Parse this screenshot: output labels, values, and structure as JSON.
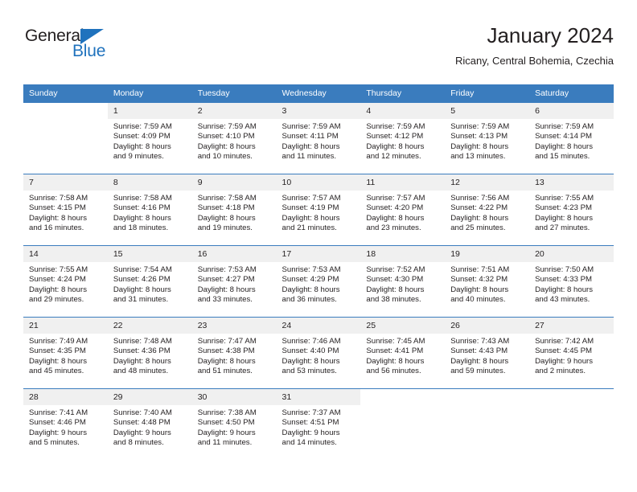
{
  "brand": {
    "name_top": "General",
    "name_bottom": "Blue",
    "color_dark": "#231f20",
    "color_blue": "#1f72bd"
  },
  "header": {
    "title": "January 2024",
    "subtitle": "Ricany, Central Bohemia, Czechia"
  },
  "theme": {
    "header_bg": "#3a7cbe",
    "daynum_bg": "#f0f0f0",
    "text": "#231f20"
  },
  "weekday_headers": [
    "Sunday",
    "Monday",
    "Tuesday",
    "Wednesday",
    "Thursday",
    "Friday",
    "Saturday"
  ],
  "weeks": [
    [
      {
        "day": "",
        "lines": []
      },
      {
        "day": "1",
        "lines": [
          "Sunrise: 7:59 AM",
          "Sunset: 4:09 PM",
          "Daylight: 8 hours",
          "and 9 minutes."
        ]
      },
      {
        "day": "2",
        "lines": [
          "Sunrise: 7:59 AM",
          "Sunset: 4:10 PM",
          "Daylight: 8 hours",
          "and 10 minutes."
        ]
      },
      {
        "day": "3",
        "lines": [
          "Sunrise: 7:59 AM",
          "Sunset: 4:11 PM",
          "Daylight: 8 hours",
          "and 11 minutes."
        ]
      },
      {
        "day": "4",
        "lines": [
          "Sunrise: 7:59 AM",
          "Sunset: 4:12 PM",
          "Daylight: 8 hours",
          "and 12 minutes."
        ]
      },
      {
        "day": "5",
        "lines": [
          "Sunrise: 7:59 AM",
          "Sunset: 4:13 PM",
          "Daylight: 8 hours",
          "and 13 minutes."
        ]
      },
      {
        "day": "6",
        "lines": [
          "Sunrise: 7:59 AM",
          "Sunset: 4:14 PM",
          "Daylight: 8 hours",
          "and 15 minutes."
        ]
      }
    ],
    [
      {
        "day": "7",
        "lines": [
          "Sunrise: 7:58 AM",
          "Sunset: 4:15 PM",
          "Daylight: 8 hours",
          "and 16 minutes."
        ]
      },
      {
        "day": "8",
        "lines": [
          "Sunrise: 7:58 AM",
          "Sunset: 4:16 PM",
          "Daylight: 8 hours",
          "and 18 minutes."
        ]
      },
      {
        "day": "9",
        "lines": [
          "Sunrise: 7:58 AM",
          "Sunset: 4:18 PM",
          "Daylight: 8 hours",
          "and 19 minutes."
        ]
      },
      {
        "day": "10",
        "lines": [
          "Sunrise: 7:57 AM",
          "Sunset: 4:19 PM",
          "Daylight: 8 hours",
          "and 21 minutes."
        ]
      },
      {
        "day": "11",
        "lines": [
          "Sunrise: 7:57 AM",
          "Sunset: 4:20 PM",
          "Daylight: 8 hours",
          "and 23 minutes."
        ]
      },
      {
        "day": "12",
        "lines": [
          "Sunrise: 7:56 AM",
          "Sunset: 4:22 PM",
          "Daylight: 8 hours",
          "and 25 minutes."
        ]
      },
      {
        "day": "13",
        "lines": [
          "Sunrise: 7:55 AM",
          "Sunset: 4:23 PM",
          "Daylight: 8 hours",
          "and 27 minutes."
        ]
      }
    ],
    [
      {
        "day": "14",
        "lines": [
          "Sunrise: 7:55 AM",
          "Sunset: 4:24 PM",
          "Daylight: 8 hours",
          "and 29 minutes."
        ]
      },
      {
        "day": "15",
        "lines": [
          "Sunrise: 7:54 AM",
          "Sunset: 4:26 PM",
          "Daylight: 8 hours",
          "and 31 minutes."
        ]
      },
      {
        "day": "16",
        "lines": [
          "Sunrise: 7:53 AM",
          "Sunset: 4:27 PM",
          "Daylight: 8 hours",
          "and 33 minutes."
        ]
      },
      {
        "day": "17",
        "lines": [
          "Sunrise: 7:53 AM",
          "Sunset: 4:29 PM",
          "Daylight: 8 hours",
          "and 36 minutes."
        ]
      },
      {
        "day": "18",
        "lines": [
          "Sunrise: 7:52 AM",
          "Sunset: 4:30 PM",
          "Daylight: 8 hours",
          "and 38 minutes."
        ]
      },
      {
        "day": "19",
        "lines": [
          "Sunrise: 7:51 AM",
          "Sunset: 4:32 PM",
          "Daylight: 8 hours",
          "and 40 minutes."
        ]
      },
      {
        "day": "20",
        "lines": [
          "Sunrise: 7:50 AM",
          "Sunset: 4:33 PM",
          "Daylight: 8 hours",
          "and 43 minutes."
        ]
      }
    ],
    [
      {
        "day": "21",
        "lines": [
          "Sunrise: 7:49 AM",
          "Sunset: 4:35 PM",
          "Daylight: 8 hours",
          "and 45 minutes."
        ]
      },
      {
        "day": "22",
        "lines": [
          "Sunrise: 7:48 AM",
          "Sunset: 4:36 PM",
          "Daylight: 8 hours",
          "and 48 minutes."
        ]
      },
      {
        "day": "23",
        "lines": [
          "Sunrise: 7:47 AM",
          "Sunset: 4:38 PM",
          "Daylight: 8 hours",
          "and 51 minutes."
        ]
      },
      {
        "day": "24",
        "lines": [
          "Sunrise: 7:46 AM",
          "Sunset: 4:40 PM",
          "Daylight: 8 hours",
          "and 53 minutes."
        ]
      },
      {
        "day": "25",
        "lines": [
          "Sunrise: 7:45 AM",
          "Sunset: 4:41 PM",
          "Daylight: 8 hours",
          "and 56 minutes."
        ]
      },
      {
        "day": "26",
        "lines": [
          "Sunrise: 7:43 AM",
          "Sunset: 4:43 PM",
          "Daylight: 8 hours",
          "and 59 minutes."
        ]
      },
      {
        "day": "27",
        "lines": [
          "Sunrise: 7:42 AM",
          "Sunset: 4:45 PM",
          "Daylight: 9 hours",
          "and 2 minutes."
        ]
      }
    ],
    [
      {
        "day": "28",
        "lines": [
          "Sunrise: 7:41 AM",
          "Sunset: 4:46 PM",
          "Daylight: 9 hours",
          "and 5 minutes."
        ]
      },
      {
        "day": "29",
        "lines": [
          "Sunrise: 7:40 AM",
          "Sunset: 4:48 PM",
          "Daylight: 9 hours",
          "and 8 minutes."
        ]
      },
      {
        "day": "30",
        "lines": [
          "Sunrise: 7:38 AM",
          "Sunset: 4:50 PM",
          "Daylight: 9 hours",
          "and 11 minutes."
        ]
      },
      {
        "day": "31",
        "lines": [
          "Sunrise: 7:37 AM",
          "Sunset: 4:51 PM",
          "Daylight: 9 hours",
          "and 14 minutes."
        ]
      },
      {
        "day": "",
        "lines": []
      },
      {
        "day": "",
        "lines": []
      },
      {
        "day": "",
        "lines": []
      }
    ]
  ]
}
